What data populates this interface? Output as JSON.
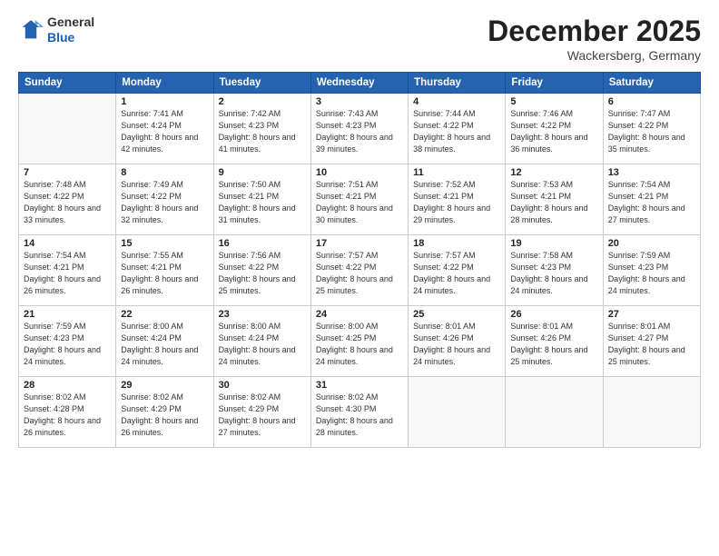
{
  "logo": {
    "general": "General",
    "blue": "Blue"
  },
  "header": {
    "month": "December 2025",
    "location": "Wackersberg, Germany"
  },
  "weekdays": [
    "Sunday",
    "Monday",
    "Tuesday",
    "Wednesday",
    "Thursday",
    "Friday",
    "Saturday"
  ],
  "weeks": [
    [
      {
        "day": "",
        "sunrise": "",
        "sunset": "",
        "daylight": ""
      },
      {
        "day": "1",
        "sunrise": "Sunrise: 7:41 AM",
        "sunset": "Sunset: 4:24 PM",
        "daylight": "Daylight: 8 hours and 42 minutes."
      },
      {
        "day": "2",
        "sunrise": "Sunrise: 7:42 AM",
        "sunset": "Sunset: 4:23 PM",
        "daylight": "Daylight: 8 hours and 41 minutes."
      },
      {
        "day": "3",
        "sunrise": "Sunrise: 7:43 AM",
        "sunset": "Sunset: 4:23 PM",
        "daylight": "Daylight: 8 hours and 39 minutes."
      },
      {
        "day": "4",
        "sunrise": "Sunrise: 7:44 AM",
        "sunset": "Sunset: 4:22 PM",
        "daylight": "Daylight: 8 hours and 38 minutes."
      },
      {
        "day": "5",
        "sunrise": "Sunrise: 7:46 AM",
        "sunset": "Sunset: 4:22 PM",
        "daylight": "Daylight: 8 hours and 36 minutes."
      },
      {
        "day": "6",
        "sunrise": "Sunrise: 7:47 AM",
        "sunset": "Sunset: 4:22 PM",
        "daylight": "Daylight: 8 hours and 35 minutes."
      }
    ],
    [
      {
        "day": "7",
        "sunrise": "Sunrise: 7:48 AM",
        "sunset": "Sunset: 4:22 PM",
        "daylight": "Daylight: 8 hours and 33 minutes."
      },
      {
        "day": "8",
        "sunrise": "Sunrise: 7:49 AM",
        "sunset": "Sunset: 4:22 PM",
        "daylight": "Daylight: 8 hours and 32 minutes."
      },
      {
        "day": "9",
        "sunrise": "Sunrise: 7:50 AM",
        "sunset": "Sunset: 4:21 PM",
        "daylight": "Daylight: 8 hours and 31 minutes."
      },
      {
        "day": "10",
        "sunrise": "Sunrise: 7:51 AM",
        "sunset": "Sunset: 4:21 PM",
        "daylight": "Daylight: 8 hours and 30 minutes."
      },
      {
        "day": "11",
        "sunrise": "Sunrise: 7:52 AM",
        "sunset": "Sunset: 4:21 PM",
        "daylight": "Daylight: 8 hours and 29 minutes."
      },
      {
        "day": "12",
        "sunrise": "Sunrise: 7:53 AM",
        "sunset": "Sunset: 4:21 PM",
        "daylight": "Daylight: 8 hours and 28 minutes."
      },
      {
        "day": "13",
        "sunrise": "Sunrise: 7:54 AM",
        "sunset": "Sunset: 4:21 PM",
        "daylight": "Daylight: 8 hours and 27 minutes."
      }
    ],
    [
      {
        "day": "14",
        "sunrise": "Sunrise: 7:54 AM",
        "sunset": "Sunset: 4:21 PM",
        "daylight": "Daylight: 8 hours and 26 minutes."
      },
      {
        "day": "15",
        "sunrise": "Sunrise: 7:55 AM",
        "sunset": "Sunset: 4:21 PM",
        "daylight": "Daylight: 8 hours and 26 minutes."
      },
      {
        "day": "16",
        "sunrise": "Sunrise: 7:56 AM",
        "sunset": "Sunset: 4:22 PM",
        "daylight": "Daylight: 8 hours and 25 minutes."
      },
      {
        "day": "17",
        "sunrise": "Sunrise: 7:57 AM",
        "sunset": "Sunset: 4:22 PM",
        "daylight": "Daylight: 8 hours and 25 minutes."
      },
      {
        "day": "18",
        "sunrise": "Sunrise: 7:57 AM",
        "sunset": "Sunset: 4:22 PM",
        "daylight": "Daylight: 8 hours and 24 minutes."
      },
      {
        "day": "19",
        "sunrise": "Sunrise: 7:58 AM",
        "sunset": "Sunset: 4:23 PM",
        "daylight": "Daylight: 8 hours and 24 minutes."
      },
      {
        "day": "20",
        "sunrise": "Sunrise: 7:59 AM",
        "sunset": "Sunset: 4:23 PM",
        "daylight": "Daylight: 8 hours and 24 minutes."
      }
    ],
    [
      {
        "day": "21",
        "sunrise": "Sunrise: 7:59 AM",
        "sunset": "Sunset: 4:23 PM",
        "daylight": "Daylight: 8 hours and 24 minutes."
      },
      {
        "day": "22",
        "sunrise": "Sunrise: 8:00 AM",
        "sunset": "Sunset: 4:24 PM",
        "daylight": "Daylight: 8 hours and 24 minutes."
      },
      {
        "day": "23",
        "sunrise": "Sunrise: 8:00 AM",
        "sunset": "Sunset: 4:24 PM",
        "daylight": "Daylight: 8 hours and 24 minutes."
      },
      {
        "day": "24",
        "sunrise": "Sunrise: 8:00 AM",
        "sunset": "Sunset: 4:25 PM",
        "daylight": "Daylight: 8 hours and 24 minutes."
      },
      {
        "day": "25",
        "sunrise": "Sunrise: 8:01 AM",
        "sunset": "Sunset: 4:26 PM",
        "daylight": "Daylight: 8 hours and 24 minutes."
      },
      {
        "day": "26",
        "sunrise": "Sunrise: 8:01 AM",
        "sunset": "Sunset: 4:26 PM",
        "daylight": "Daylight: 8 hours and 25 minutes."
      },
      {
        "day": "27",
        "sunrise": "Sunrise: 8:01 AM",
        "sunset": "Sunset: 4:27 PM",
        "daylight": "Daylight: 8 hours and 25 minutes."
      }
    ],
    [
      {
        "day": "28",
        "sunrise": "Sunrise: 8:02 AM",
        "sunset": "Sunset: 4:28 PM",
        "daylight": "Daylight: 8 hours and 26 minutes."
      },
      {
        "day": "29",
        "sunrise": "Sunrise: 8:02 AM",
        "sunset": "Sunset: 4:29 PM",
        "daylight": "Daylight: 8 hours and 26 minutes."
      },
      {
        "day": "30",
        "sunrise": "Sunrise: 8:02 AM",
        "sunset": "Sunset: 4:29 PM",
        "daylight": "Daylight: 8 hours and 27 minutes."
      },
      {
        "day": "31",
        "sunrise": "Sunrise: 8:02 AM",
        "sunset": "Sunset: 4:30 PM",
        "daylight": "Daylight: 8 hours and 28 minutes."
      },
      {
        "day": "",
        "sunrise": "",
        "sunset": "",
        "daylight": ""
      },
      {
        "day": "",
        "sunrise": "",
        "sunset": "",
        "daylight": ""
      },
      {
        "day": "",
        "sunrise": "",
        "sunset": "",
        "daylight": ""
      }
    ]
  ]
}
